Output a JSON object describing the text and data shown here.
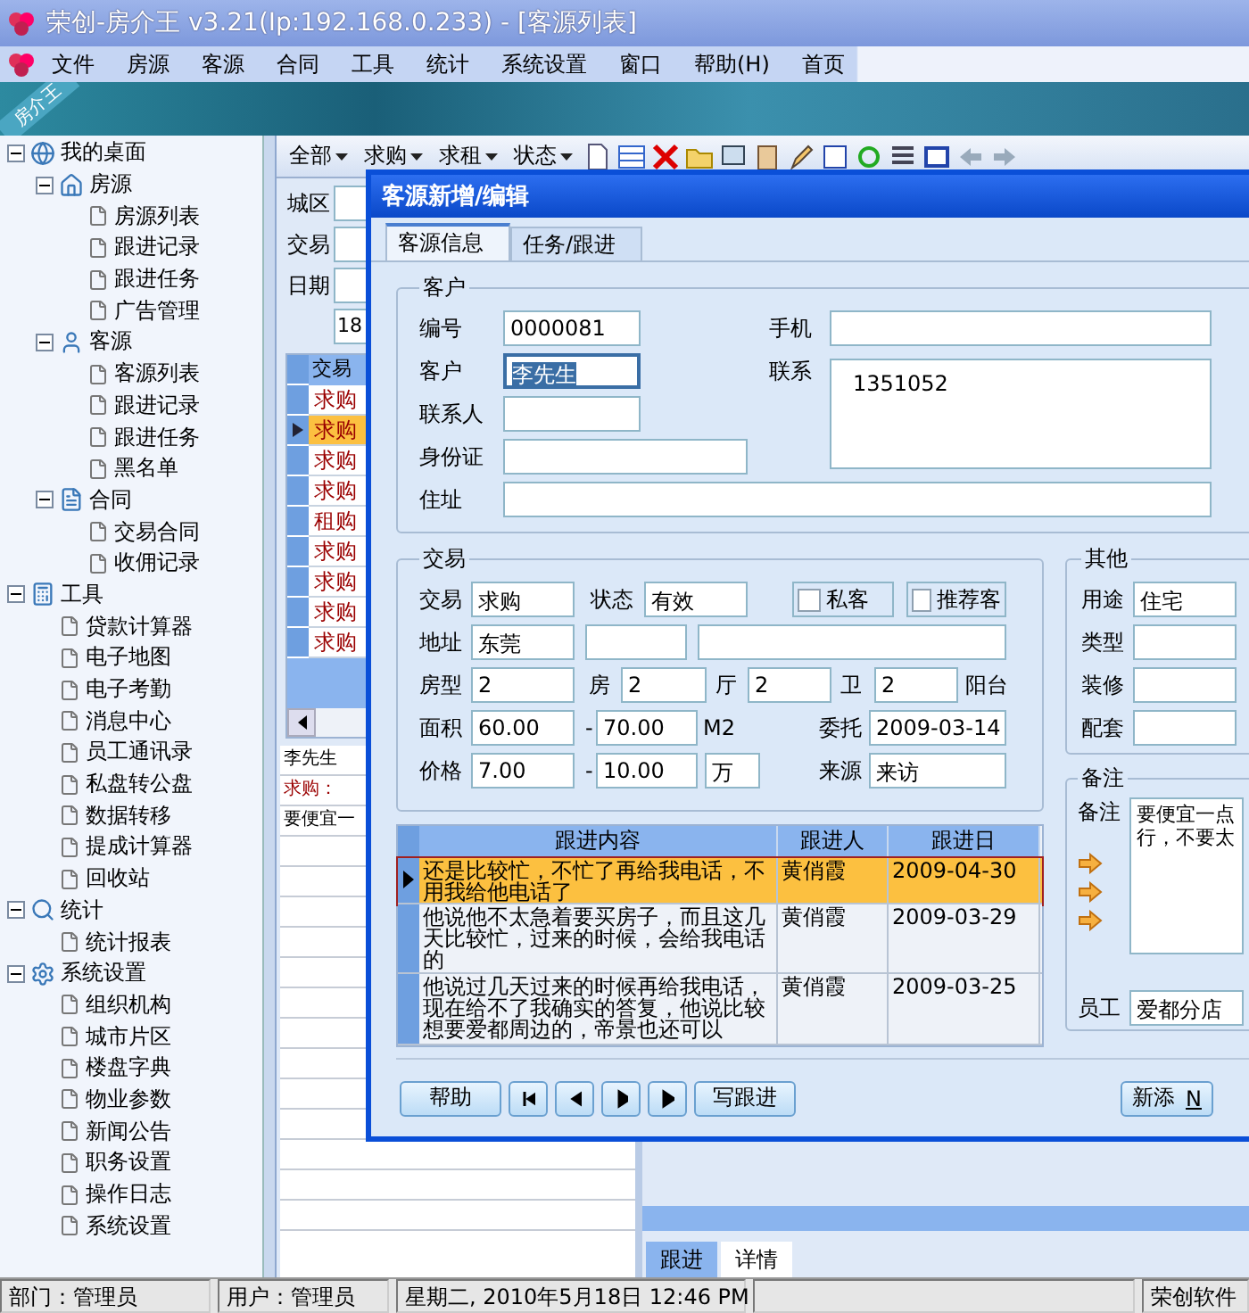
{
  "window": {
    "title": "荣创-房介王 v3.21(Ip:192.168.0.233) - [客源列表]"
  },
  "menu": [
    "文件",
    "房源",
    "客源",
    "合同",
    "工具",
    "统计",
    "系统设置",
    "窗口",
    "帮助(H)",
    "首页"
  ],
  "banner": {
    "badge": "房介王"
  },
  "tree": [
    {
      "label": "我的桌面",
      "expanded": true,
      "children": [
        {
          "label": "房源",
          "expanded": true,
          "children": [
            {
              "label": "房源列表"
            },
            {
              "label": "跟进记录"
            },
            {
              "label": "跟进任务"
            },
            {
              "label": "广告管理"
            }
          ]
        },
        {
          "label": "客源",
          "expanded": true,
          "children": [
            {
              "label": "客源列表"
            },
            {
              "label": "跟进记录"
            },
            {
              "label": "跟进任务"
            },
            {
              "label": "黑名单"
            }
          ]
        },
        {
          "label": "合同",
          "expanded": true,
          "children": [
            {
              "label": "交易合同"
            },
            {
              "label": "收佣记录"
            }
          ]
        }
      ]
    },
    {
      "label": "工具",
      "expanded": true,
      "children": [
        {
          "label": "贷款计算器"
        },
        {
          "label": "电子地图"
        },
        {
          "label": "电子考勤"
        },
        {
          "label": "消息中心"
        },
        {
          "label": "员工通讯录"
        },
        {
          "label": "私盘转公盘"
        },
        {
          "label": "数据转移"
        },
        {
          "label": "提成计算器"
        },
        {
          "label": "回收站"
        }
      ]
    },
    {
      "label": "统计",
      "expanded": true,
      "children": [
        {
          "label": "统计报表"
        }
      ]
    },
    {
      "label": "系统设置",
      "expanded": true,
      "children": [
        {
          "label": "组织机构"
        },
        {
          "label": "城市片区"
        },
        {
          "label": "楼盘字典"
        },
        {
          "label": "物业参数"
        },
        {
          "label": "新闻公告"
        },
        {
          "label": "职务设置"
        },
        {
          "label": "操作日志"
        },
        {
          "label": "系统设置"
        }
      ]
    }
  ],
  "toolbar": {
    "filters": [
      "全部",
      "求购",
      "求租",
      "状态"
    ]
  },
  "filter_panel": {
    "labels": [
      "城区",
      "交易",
      "日期"
    ],
    "date_field": "18"
  },
  "list_grid": {
    "header": "交易",
    "rows": [
      {
        "trade": "求购",
        "selected": false
      },
      {
        "trade": "求购",
        "selected": true
      },
      {
        "trade": "求购",
        "selected": false
      },
      {
        "trade": "求购",
        "selected": false
      },
      {
        "trade": "租购",
        "selected": false
      },
      {
        "trade": "求购",
        "selected": false
      },
      {
        "trade": "求购",
        "selected": false
      },
      {
        "trade": "求购",
        "selected": false
      },
      {
        "trade": "求购",
        "selected": false
      }
    ]
  },
  "detail_lines": [
    {
      "kind": "name",
      "text": "李先生"
    },
    {
      "kind": "demand",
      "text": "求购："
    },
    {
      "kind": "note",
      "text": "要便宜一"
    }
  ],
  "bottom_tabs": [
    {
      "label": "跟进",
      "selected": true
    },
    {
      "label": "详情",
      "selected": false
    }
  ],
  "status_bar": [
    "部门：管理员",
    "用户：管理员",
    "星期二, 2010年5月18日 12:46 PM",
    "荣创软件"
  ],
  "dialog": {
    "title": "客源新增/编辑",
    "tabs": [
      {
        "label": "客源信息",
        "selected": true
      },
      {
        "label": "任务/跟进",
        "selected": false
      }
    ],
    "customer": {
      "legend": "客户",
      "fields": [
        {
          "label": "编号",
          "value": "0000081",
          "focused": false
        },
        {
          "label": "手机",
          "focused": false
        },
        {
          "label": "客户",
          "value": "李先生",
          "focused": true
        },
        {
          "label": "联系",
          "value": "1351052",
          "focused": false
        },
        {
          "label": "联系人",
          "focused": false
        },
        {
          "label": "身份证",
          "focused": false
        },
        {
          "label": "住址",
          "focused": false
        }
      ]
    },
    "trade": {
      "legend": "交易",
      "rows": [
        {
          "items": [
            {
              "kind": "label",
              "text": "交易"
            },
            {
              "kind": "field",
              "value": "求购"
            },
            {
              "kind": "label",
              "text": "状态"
            },
            {
              "kind": "field",
              "value": "有效"
            },
            {
              "kind": "check",
              "text": "私客",
              "checked": false
            },
            {
              "kind": "check",
              "text": "推荐客",
              "checked": false
            }
          ]
        },
        {
          "items": [
            {
              "kind": "label",
              "text": "地址"
            },
            {
              "kind": "field",
              "value": "东莞"
            },
            {
              "kind": "field"
            },
            {
              "kind": "field"
            }
          ]
        },
        {
          "items": [
            {
              "kind": "label",
              "text": "房型"
            },
            {
              "kind": "field",
              "value": "2"
            },
            {
              "kind": "label",
              "text": "房"
            },
            {
              "kind": "field",
              "value": "2"
            },
            {
              "kind": "label",
              "text": "厅"
            },
            {
              "kind": "field",
              "value": "2"
            },
            {
              "kind": "label",
              "text": "卫"
            },
            {
              "kind": "field",
              "value": "2"
            },
            {
              "kind": "label",
              "text": "阳台"
            }
          ]
        },
        {
          "items": [
            {
              "kind": "label",
              "text": "面积"
            },
            {
              "kind": "field",
              "value": "60.00"
            },
            {
              "kind": "label",
              "text": "-"
            },
            {
              "kind": "field",
              "value": "70.00"
            },
            {
              "kind": "label",
              "text": "M2"
            },
            {
              "kind": "label",
              "text": "委托"
            },
            {
              "kind": "field",
              "value": "2009-03-14"
            }
          ]
        },
        {
          "items": [
            {
              "kind": "label",
              "text": "价格"
            },
            {
              "kind": "field",
              "value": "7.00"
            },
            {
              "kind": "label",
              "text": "-"
            },
            {
              "kind": "field",
              "value": "10.00"
            },
            {
              "kind": "field",
              "value": "万"
            },
            {
              "kind": "label",
              "text": "来源"
            },
            {
              "kind": "field",
              "value": "来访"
            }
          ]
        }
      ]
    },
    "other": {
      "legend": "其他",
      "fields": [
        {
          "label": "用途",
          "value": "住宅"
        },
        {
          "label": "类型"
        },
        {
          "label": "装修"
        },
        {
          "label": "配套"
        }
      ]
    },
    "remark": {
      "legend": "备注",
      "label": "备注",
      "text": "要便宜一点行，不要太",
      "staff": {
        "label": "员工",
        "value": "爱都分店"
      }
    },
    "followups": {
      "columns": [
        "跟进内容",
        "跟进人",
        "跟进日"
      ],
      "rows": [
        {
          "content": "还是比较忙，不忙了再给我电话，不用我给他电话了",
          "person": "黄俏霞",
          "date": "2009-04-30",
          "selected": true
        },
        {
          "content": "他说他不太急着要买房子，而且这几天比较忙，过来的时候，会给我电话的",
          "person": "黄俏霞",
          "date": "2009-03-29",
          "selected": false
        },
        {
          "content": "他说过几天过来的时候再给我电话，现在给不了我确实的答复，他说比较想要爱都周边的，帝景也还可以",
          "person": "黄俏霞",
          "date": "2009-03-25",
          "selected": false
        }
      ]
    },
    "buttons": {
      "help": "帮助",
      "follow": "写跟进",
      "add": {
        "label": "新添",
        "shortcut": "N"
      }
    }
  }
}
